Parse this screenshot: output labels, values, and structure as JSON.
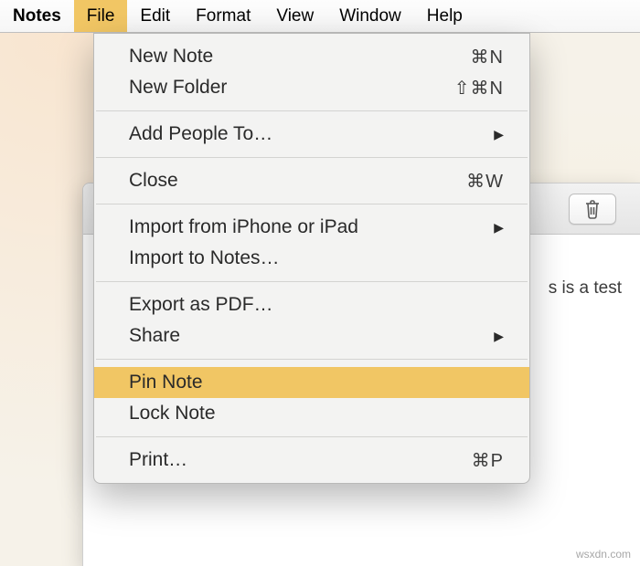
{
  "menubar": {
    "app": "Notes",
    "items": [
      {
        "label": "File",
        "active": true
      },
      {
        "label": "Edit"
      },
      {
        "label": "Format"
      },
      {
        "label": "View"
      },
      {
        "label": "Window"
      },
      {
        "label": "Help"
      }
    ]
  },
  "file_menu": {
    "new_note": {
      "label": "New Note",
      "shortcut": "⌘N"
    },
    "new_folder": {
      "label": "New Folder",
      "shortcut": "⇧⌘N"
    },
    "add_people": {
      "label": "Add People To…"
    },
    "close": {
      "label": "Close",
      "shortcut": "⌘W"
    },
    "import_iphone": {
      "label": "Import from iPhone or iPad"
    },
    "import_notes": {
      "label": "Import to Notes…"
    },
    "export_pdf": {
      "label": "Export as PDF…"
    },
    "share": {
      "label": "Share"
    },
    "pin_note": {
      "label": "Pin Note"
    },
    "lock_note": {
      "label": "Lock Note"
    },
    "print": {
      "label": "Print…",
      "shortcut": "⌘P"
    }
  },
  "note": {
    "visible_text": "s is a test"
  },
  "watermark": "wsxdn.com"
}
